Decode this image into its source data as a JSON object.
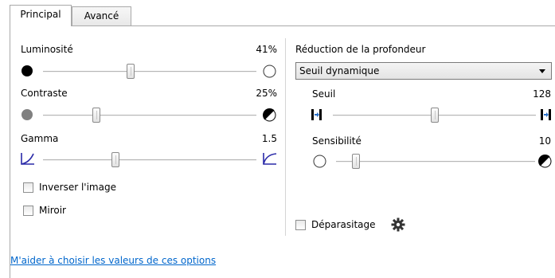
{
  "tabs": [
    "Principal",
    "Avancé"
  ],
  "left": {
    "brightness": {
      "label": "Luminosité",
      "value": "41%",
      "level": 0.41
    },
    "contrast": {
      "label": "Contraste",
      "value": "25%",
      "level": 0.25
    },
    "gamma": {
      "label": "Gamma",
      "value": "1.5",
      "level": 0.34
    },
    "invert_label": "Inverser l'image",
    "mirror_label": "Miroir"
  },
  "right": {
    "depth_title": "Réduction de la profondeur",
    "depth_selected": "Seuil dynamique",
    "threshold": {
      "label": "Seuil",
      "value": "128",
      "level": 0.5
    },
    "sensitivity": {
      "label": "Sensibilité",
      "value": "10",
      "level": 0.1
    },
    "despeckle_label": "Déparasitage"
  },
  "help_link": "M'aider à choisir les valeurs de ces options"
}
